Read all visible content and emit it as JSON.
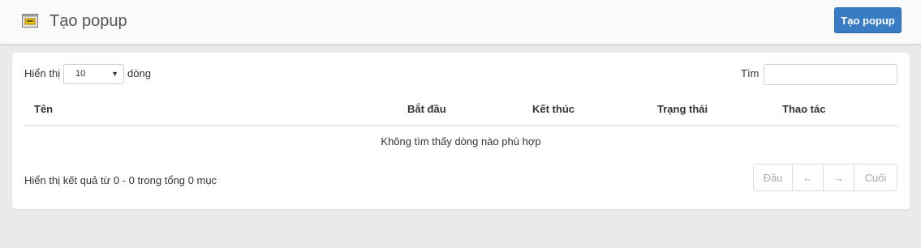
{
  "header": {
    "title": "Tạo popup",
    "icon": "popup-window-icon",
    "create_button": "Tạo popup"
  },
  "table_controls": {
    "show_label": "Hiển thị",
    "page_length": "10",
    "rows_label": "dòng",
    "search_label": "Tìm",
    "search_value": ""
  },
  "table": {
    "columns": [
      "Tên",
      "Bắt đầu",
      "Kết thúc",
      "Trạng thái",
      "Thao tác"
    ],
    "empty_message": "Không tìm thấy dòng nào phù hợp"
  },
  "footer": {
    "info": "Hiển thị kết quả từ 0 - 0 trong tổng 0 mục",
    "pagination": {
      "first": "Đầu",
      "prev": "←",
      "next": "→",
      "last": "Cuối"
    }
  },
  "colors": {
    "primary": "#3a7cc4",
    "background": "#e9eaec",
    "disabled_text": "#a9a9a9"
  }
}
